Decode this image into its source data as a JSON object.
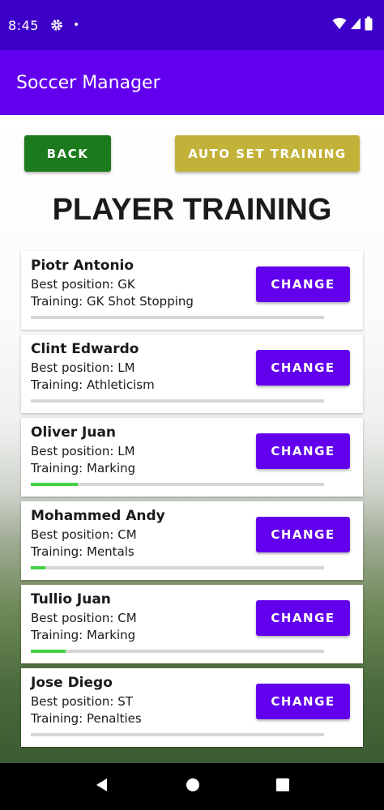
{
  "status_bar": {
    "time": "8:45",
    "dot": "•"
  },
  "app_bar": {
    "title": "Soccer Manager"
  },
  "buttons": {
    "back": "BACK",
    "auto_set_training": "AUTO SET TRAINING"
  },
  "page": {
    "title": "PLAYER TRAINING"
  },
  "change_label": "CHANGE",
  "players": [
    {
      "name": "Piotr Antonio",
      "position": "Best position: GK",
      "training": "Training: GK Shot Stopping",
      "progress_percent": 0
    },
    {
      "name": "Clint Edwardo",
      "position": "Best position: LM",
      "training": "Training: Athleticism",
      "progress_percent": 0
    },
    {
      "name": "Oliver Juan",
      "position": "Best position: LM",
      "training": "Training: Marking",
      "progress_percent": 16
    },
    {
      "name": "Mohammed Andy",
      "position": "Best position: CM",
      "training": "Training: Mentals",
      "progress_percent": 5
    },
    {
      "name": "Tullio Juan",
      "position": "Best position: CM",
      "training": "Training: Marking",
      "progress_percent": 12
    },
    {
      "name": "Jose Diego",
      "position": "Best position: ST",
      "training": "Training: Penalties",
      "progress_percent": 0
    }
  ],
  "colors": {
    "status_bar": "#3d00c8",
    "app_bar": "#6200ee",
    "back_button": "#1b7a1b",
    "auto_button": "#c3b23a",
    "change_button": "#6200ee",
    "progress_fill": "#44d044"
  },
  "icons": [
    "settings-gear-icon",
    "wifi-icon",
    "cellular-signal-icon",
    "battery-icon",
    "back-nav-icon",
    "home-nav-icon",
    "recents-nav-icon"
  ]
}
